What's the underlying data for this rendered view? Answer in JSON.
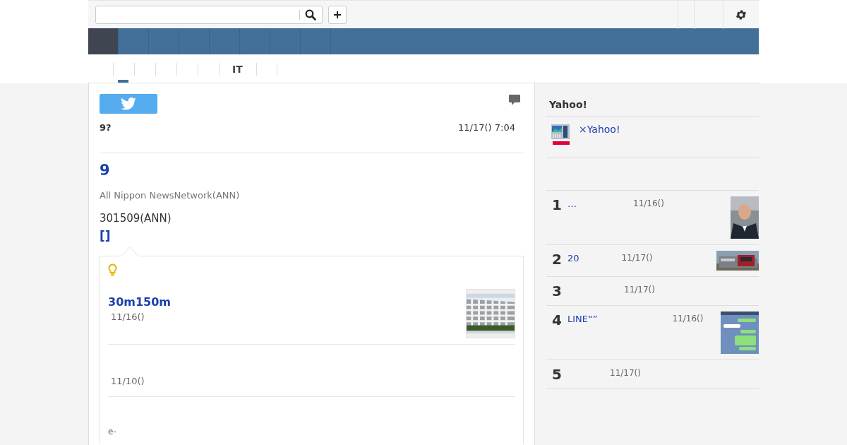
{
  "nav": [
    {
      "selected": true
    },
    {
      "selected": false
    },
    {
      "selected": false
    },
    {
      "selected": false
    },
    {
      "selected": false
    },
    {
      "selected": false
    },
    {
      "selected": false
    },
    {
      "selected": false
    }
  ],
  "tabs": [
    {
      "selected": true
    },
    {
      "selected": false
    },
    {
      "selected": false
    },
    {
      "selected": false
    },
    {
      "selected": false
    },
    {
      "label": "IT",
      "selected": false
    },
    {
      "selected": false
    }
  ],
  "article": {
    "kicker": "9?",
    "time": "11/17() 7:04",
    "headline": "9",
    "source": "All Nippon NewsNetwork(ANN)",
    "body": "301509(ANN)",
    "more_link": "[]",
    "related": [
      {
        "title": "30m150m",
        "date": "11/16()"
      },
      {
        "date": "11/10()"
      },
      {
        "snippet": "e-"
      }
    ]
  },
  "sidebar": {
    "heading": "Yahoo!",
    "promo": "×Yahoo!",
    "ranking": [
      {
        "rank": "1",
        "title": "…",
        "date": "11/16()"
      },
      {
        "rank": "2",
        "title": "20",
        "date": "11/17()"
      },
      {
        "rank": "3",
        "date": "11/17()"
      },
      {
        "rank": "4",
        "title": "LINE“”",
        "date": "11/16()"
      },
      {
        "rank": "5",
        "date": "11/17()"
      }
    ]
  }
}
